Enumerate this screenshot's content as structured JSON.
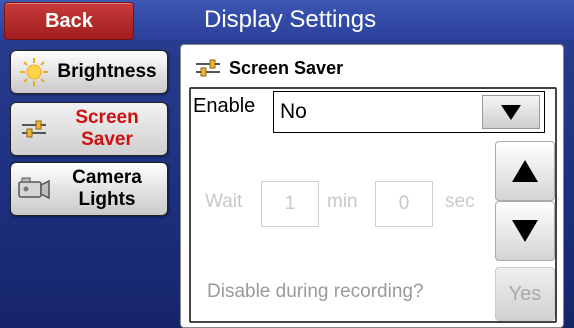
{
  "header": {
    "back_label": "Back",
    "title": "Display Settings"
  },
  "sidebar": {
    "items": [
      {
        "label": "Brightness",
        "icon": "sun-icon",
        "selected": false
      },
      {
        "label_line1": "Screen",
        "label_line2": "Saver",
        "icon": "sliders-icon",
        "selected": true
      },
      {
        "label_line1": "Camera",
        "label_line2": "Lights",
        "icon": "camera-icon",
        "selected": false
      }
    ]
  },
  "panel": {
    "title": "Screen Saver",
    "icon": "sliders-icon",
    "enable": {
      "label": "Enable",
      "value": "No"
    },
    "wait": {
      "label": "Wait",
      "minutes": "1",
      "min_label": "min",
      "seconds": "0",
      "sec_label": "sec"
    },
    "disable_during_recording": {
      "label": "Disable during recording?",
      "value": "Yes"
    }
  },
  "colors": {
    "back_button": "#b52a2a",
    "selected_tab_text": "#cc1111",
    "background": "#22357f"
  }
}
